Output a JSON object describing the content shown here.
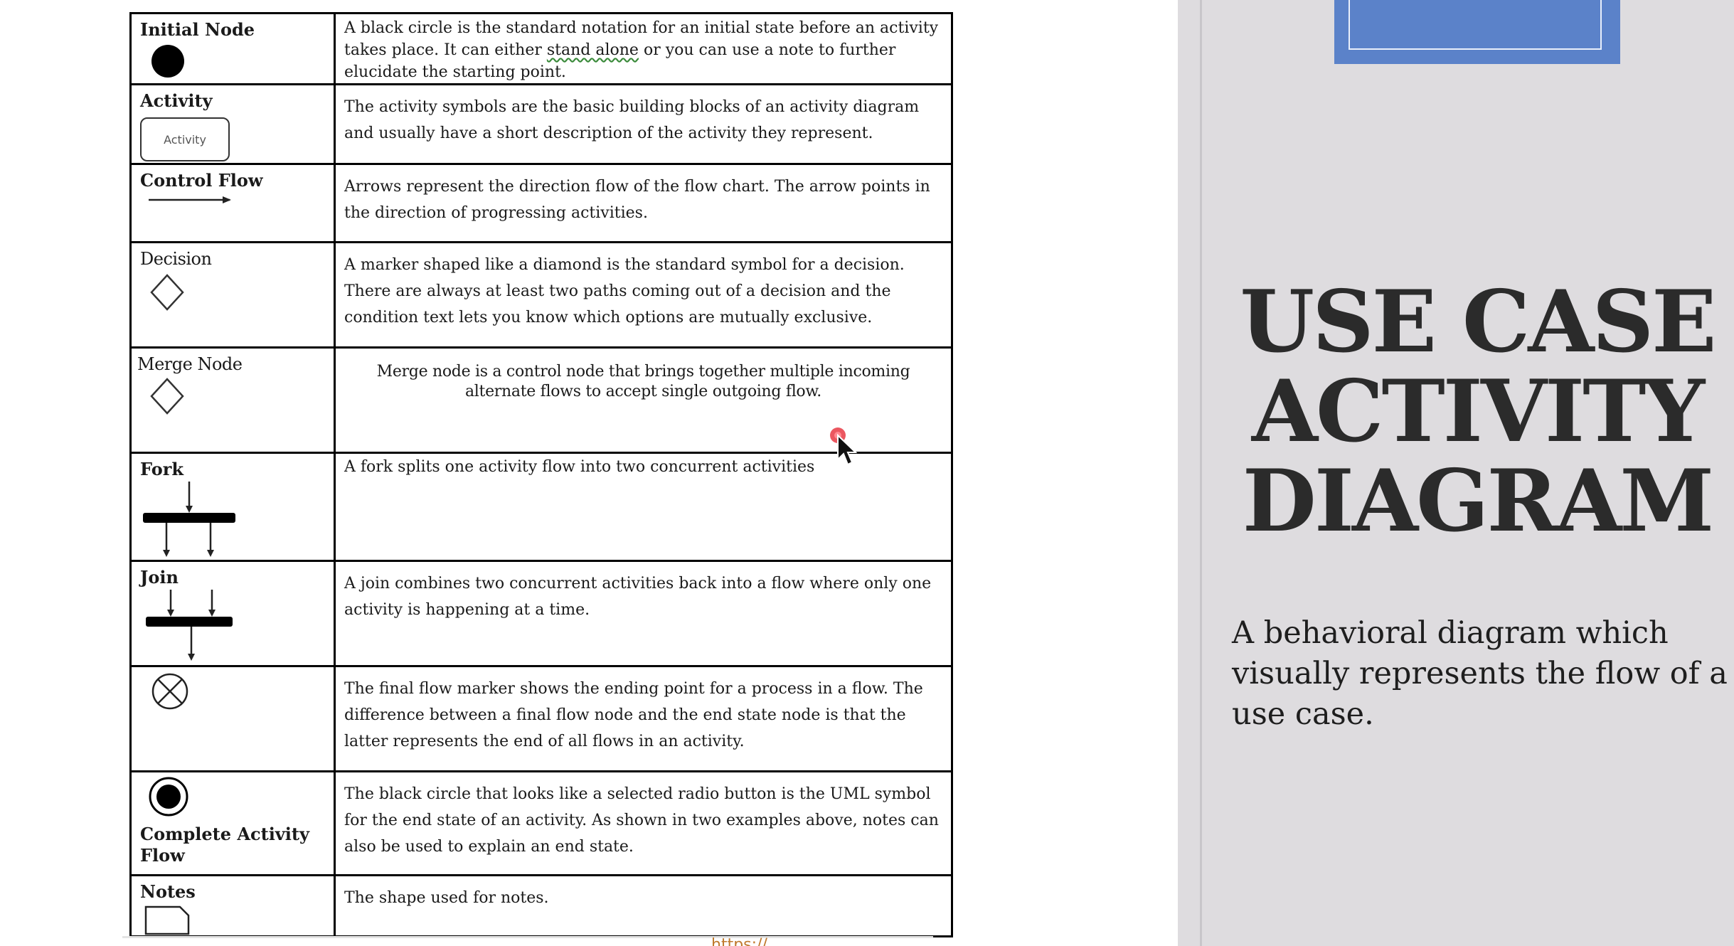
{
  "document": {
    "rows": [
      {
        "name": "Initial Node",
        "symbol": "filled-circle-icon",
        "desc_parts": [
          "A black circle is the standard notation for an initial state before an activity takes place. It can either ",
          "stand alone",
          " or you can use a note to further elucidate the starting point."
        ]
      },
      {
        "name": "Activity",
        "symbol": "activity-rounded-rect-icon",
        "symbol_label": "Activity",
        "description": "The activity symbols are the basic building blocks of an activity diagram and usually have a short description of the activity they represent."
      },
      {
        "name": "Control Flow",
        "symbol": "arrow-right-icon",
        "description": "Arrows represent the direction flow of the flow chart. The arrow points in the direction of progressing activities."
      },
      {
        "name": "Decision",
        "symbol": "diamond-icon",
        "description": "A marker shaped like a diamond is the standard symbol for a decision. There are always at least two paths coming out of a decision and the condition text lets you know which options are mutually exclusive."
      },
      {
        "name": "Merge Node",
        "symbol": "diamond-icon",
        "description": "Merge node is a control node that brings together multiple incoming alternate flows to accept single outgoing flow."
      },
      {
        "name": "Fork",
        "symbol": "fork-bar-icon",
        "description": "A fork splits one activity flow into two concurrent activities"
      },
      {
        "name": "Join",
        "symbol": "join-bar-icon",
        "description": "A join combines two concurrent activities back into a flow where only one activity is happening at a time."
      },
      {
        "name": "",
        "symbol": "circle-x-icon",
        "description": "The final flow marker shows the ending point for a process in a flow. The difference between a final flow node and the end state node is that the latter represents the end of all flows in an activity."
      },
      {
        "name": "Complete Activity Flow",
        "symbol": "bullseye-icon",
        "description": "The black circle that looks like a selected radio button is the UML symbol for the end state of an activity. As shown in two examples above, notes can also be used to explain an end state."
      },
      {
        "name": "Notes",
        "symbol": "note-icon",
        "description": "The shape used for notes."
      }
    ],
    "footer_url_fragment": "https://..."
  },
  "slide": {
    "title_lines": [
      "USE CASE",
      "ACTIVITY",
      "DIAGRAM"
    ],
    "subtitle": "A behavioral diagram which visually represents the flow of a use case.",
    "colors": {
      "background": "#dedcdf",
      "accent_rect": "#5b82c9",
      "title": "#2b2b2b"
    }
  }
}
